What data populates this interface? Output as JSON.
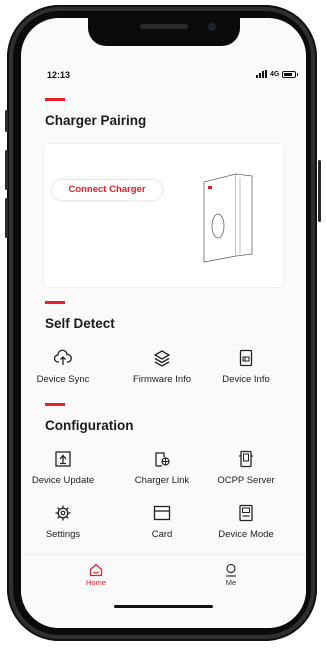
{
  "status_bar": {
    "time": "12:13",
    "network": "4G"
  },
  "charger_pairing": {
    "title": "Charger Pairing",
    "connect_button": "Connect Charger"
  },
  "self_detect": {
    "title": "Self Detect",
    "items": [
      {
        "label": "Device Sync",
        "icon": "cloud-sync-icon"
      },
      {
        "label": "Firmware Info",
        "icon": "layers-icon"
      },
      {
        "label": "Device Info",
        "icon": "device-info-icon"
      }
    ]
  },
  "configuration": {
    "title": "Configuration",
    "items": [
      {
        "label": "Device Update",
        "icon": "upload-box-icon"
      },
      {
        "label": "Charger Link",
        "icon": "charger-link-icon"
      },
      {
        "label": "OCPP Server",
        "icon": "server-icon"
      },
      {
        "label": "Settings",
        "icon": "gear-icon"
      },
      {
        "label": "Card",
        "icon": "card-icon"
      },
      {
        "label": "Device Mode",
        "icon": "device-mode-icon"
      }
    ]
  },
  "tabbar": {
    "tabs": [
      {
        "label": "Home",
        "icon": "home-icon",
        "active": true
      },
      {
        "label": "Me",
        "icon": "user-icon",
        "active": false
      }
    ]
  },
  "colors": {
    "accent": "#e4202a",
    "text": "#1c1c1c",
    "frame": "#2f2f2f"
  }
}
